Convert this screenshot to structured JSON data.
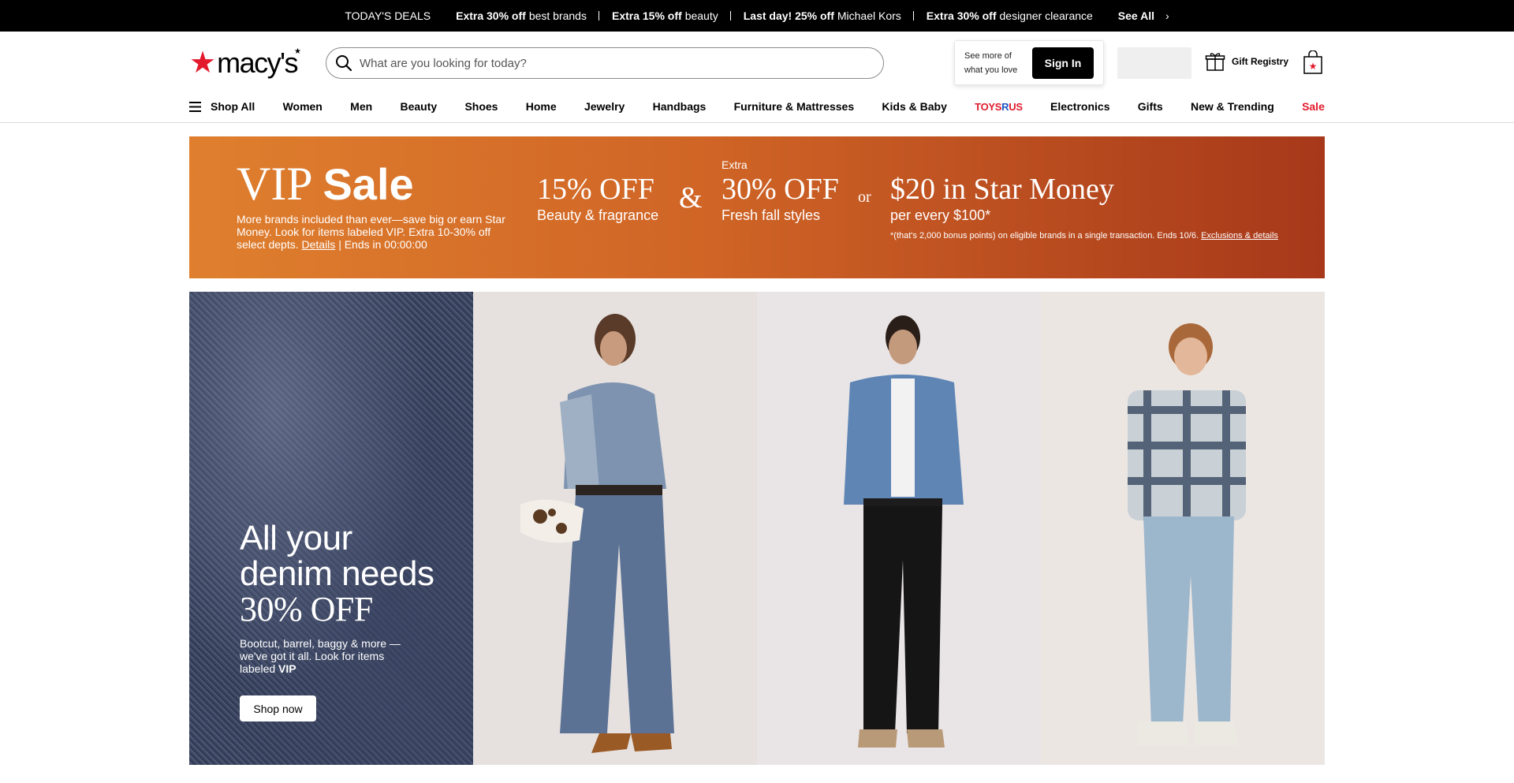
{
  "deals_bar": {
    "todays_deals": "TODAY'S DEALS",
    "deals": [
      {
        "bold": "Extra 30% off",
        "rest": "best brands"
      },
      {
        "bold": "Extra 15% off",
        "rest": "beauty"
      },
      {
        "bold": "Last day! 25% off",
        "rest": "Michael Kors"
      },
      {
        "bold": "Extra 30% off",
        "rest": "designer clearance"
      }
    ],
    "see_all": "See All"
  },
  "header": {
    "logo_text": "macy's",
    "search_placeholder": "What are you looking for today?",
    "see_more_line1": "See more of",
    "see_more_line2": "what you love",
    "sign_in": "Sign In",
    "gift_registry": "Gift Registry"
  },
  "nav": {
    "shop_all": "Shop All",
    "items": [
      "Women",
      "Men",
      "Beauty",
      "Shoes",
      "Home",
      "Jewelry",
      "Handbags",
      "Furniture & Mattresses",
      "Kids & Baby"
    ],
    "toys": {
      "t1": "TOYS",
      "r": "R",
      "t2": "US"
    },
    "items2": [
      "Electronics",
      "Gifts",
      "New & Trending"
    ],
    "sale": "Sale"
  },
  "vip_banner": {
    "title_vip": "VIP",
    "title_sale": "Sale",
    "description": "More brands included than ever—save big or earn Star Money. Look for items labeled VIP. Extra 10-30% off select depts.",
    "details_link": "Details",
    "ends": "| Ends in 00:00:00",
    "offer1_big": "15% OFF",
    "offer1_sub": "Beauty & fragrance",
    "ampersand": "&",
    "offer2_extra": "Extra",
    "offer2_big": "30% OFF",
    "offer2_sub": "Fresh fall styles",
    "or": "or",
    "offer3_big": "$20 in Star Money",
    "offer3_sub": "per every $100*",
    "fine_print": "*(that's 2,000 bonus points) on eligible brands in a single transaction. Ends 10/6.",
    "exclusions_link": "Exclusions & details"
  },
  "hero": {
    "headline_line1": "All your",
    "headline_line2": "denim needs",
    "headline_line3": "30% OFF",
    "copy": "Bootcut, barrel, baggy & more —we've got it all. Look for items labeled",
    "copy_bold": "VIP",
    "shop_now": "Shop now"
  }
}
